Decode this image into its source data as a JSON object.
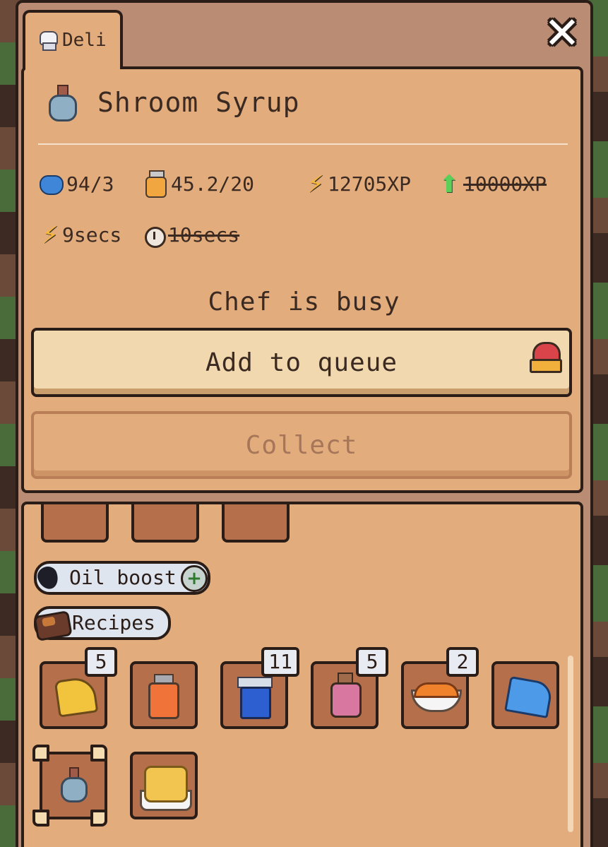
{
  "window": {
    "tab_label": "Deli",
    "close_symbol": "✕"
  },
  "recipe": {
    "name": "Shroom Syrup",
    "icon": "potion-icon"
  },
  "stats": {
    "gem": "94/3",
    "jar": "45.2/20",
    "xp": "12705XP",
    "xp_original": "10000XP",
    "time": "9secs",
    "time_original": "10secs"
  },
  "status_text": "Chef is busy",
  "buttons": {
    "queue_label": "Add to queue",
    "collect_label": "Collect"
  },
  "boosts": {
    "oil_label": "Oil boost",
    "plus_symbol": "+",
    "recipes_label": "Recipes"
  },
  "recipe_items": [
    {
      "icon": "cheese-icon",
      "count": "5"
    },
    {
      "icon": "jam-jar-icon",
      "count": ""
    },
    {
      "icon": "blue-jar-icon",
      "count": "11"
    },
    {
      "icon": "potion-jar-icon",
      "count": "5"
    },
    {
      "icon": "pie-icon",
      "count": "2"
    },
    {
      "icon": "blue-cheese-icon",
      "count": ""
    },
    {
      "icon": "shroom-syrup-icon",
      "count": "",
      "selected": true
    },
    {
      "icon": "pancake-icon",
      "count": ""
    }
  ],
  "colors": {
    "panel": "#e3ac7c",
    "frame": "#b98c73",
    "border": "#2a1d18",
    "text": "#3b2a22",
    "button": "#f1d8af",
    "disabled_text": "#a5765a"
  }
}
